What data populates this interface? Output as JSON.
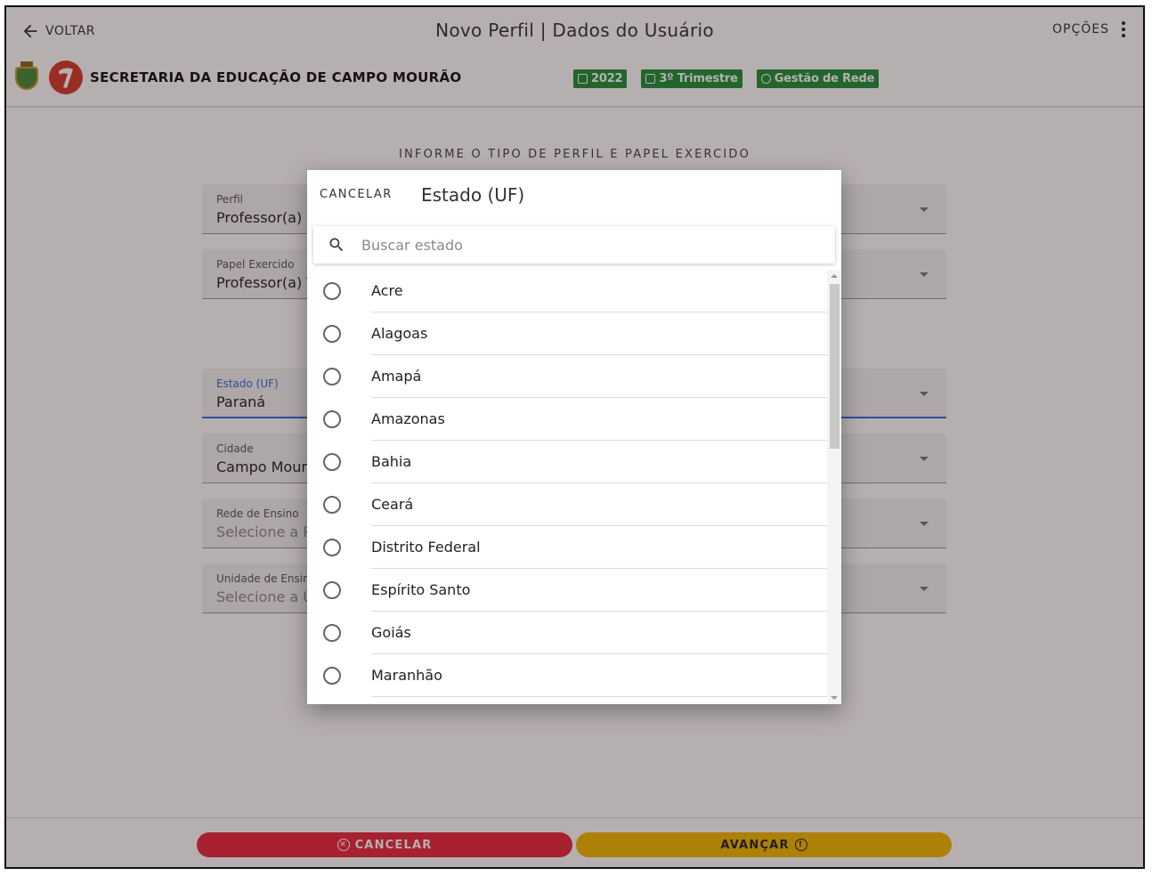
{
  "header": {
    "back_label": "VOLTAR",
    "title": "Novo Perfil | Dados do Usuário",
    "options_label": "OPÇÕES",
    "org_name": "SECRETARIA DA EDUCAÇÃO DE CAMPO MOURÃO",
    "badges": [
      {
        "label": "2022",
        "icon": "calendar-icon"
      },
      {
        "label": "3º Trimestre",
        "icon": "calendar-icon"
      },
      {
        "label": "Gestão de Rede",
        "icon": "check-circle-icon"
      }
    ]
  },
  "form": {
    "section_title": "INFORME O TIPO DE PERFIL E PAPEL EXERCIDO",
    "fields": [
      {
        "label": "Perfil",
        "value": "Professor(a)"
      },
      {
        "label": "Papel Exercido",
        "value": "Professor(a) T"
      },
      {
        "label": "Estado (UF)",
        "value": "Paraná"
      },
      {
        "label": "Cidade",
        "value": "Campo Mour"
      },
      {
        "label": "Rede de Ensino",
        "value": "Selecione a R"
      },
      {
        "label": "Unidade de Ensin",
        "value": "Selecione a U"
      }
    ]
  },
  "footer": {
    "cancel_label": "CANCELAR",
    "next_label": "AVANÇAR"
  },
  "modal": {
    "cancel_label": "CANCELAR",
    "title": "Estado (UF)",
    "search_placeholder": "Buscar estado",
    "items": [
      "Acre",
      "Alagoas",
      "Amapá",
      "Amazonas",
      "Bahia",
      "Ceará",
      "Distrito Federal",
      "Espírito Santo",
      "Goiás",
      "Maranhão"
    ]
  },
  "colors": {
    "badge_green": "#1f8f3a",
    "cancel_red": "#e8283f",
    "next_yellow": "#f2b900",
    "active_blue": "#2f6fd6"
  }
}
